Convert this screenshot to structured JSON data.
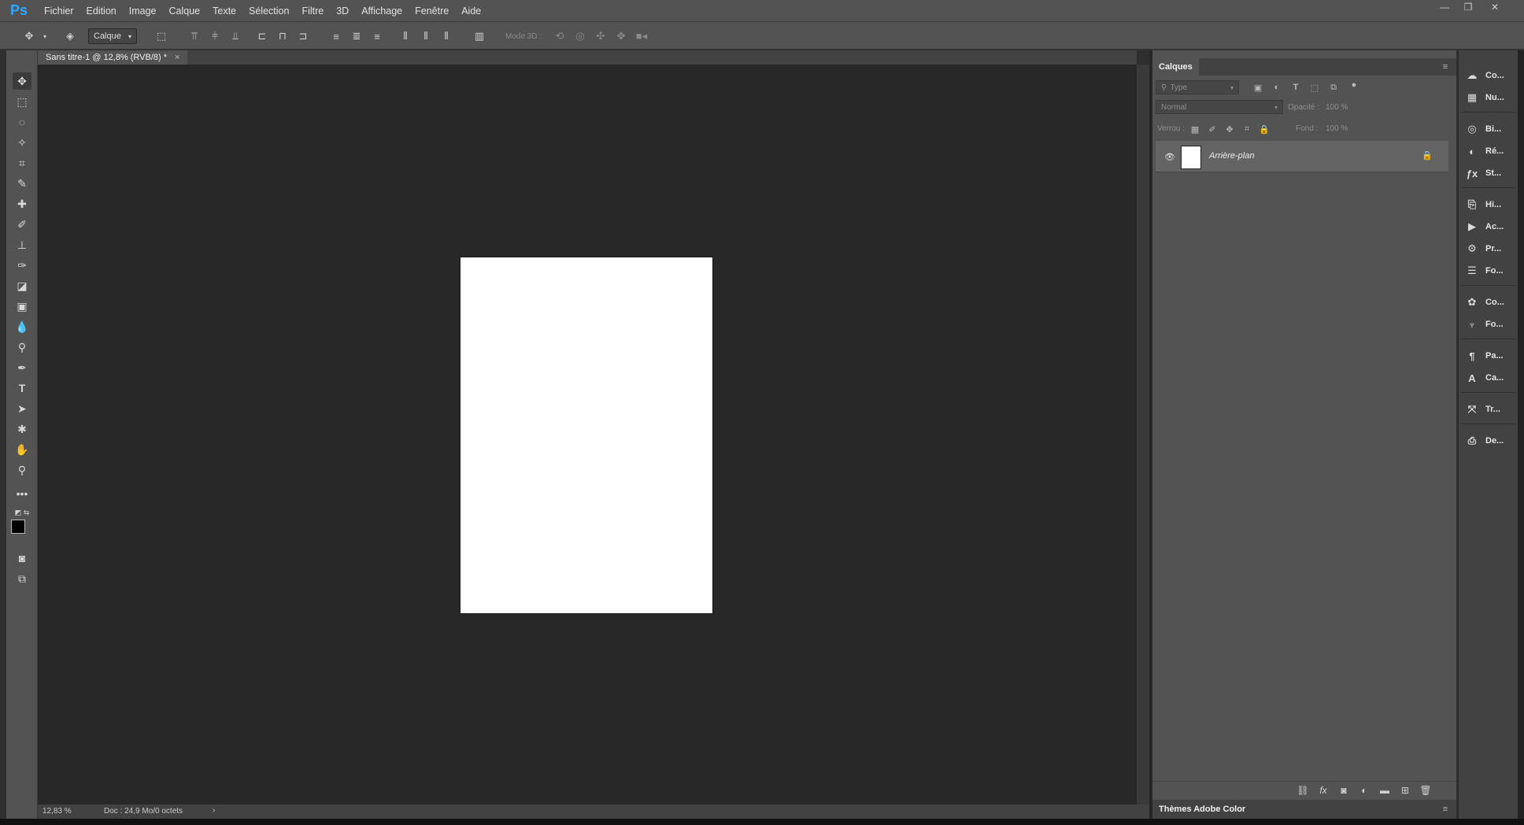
{
  "app": {
    "logo": "Ps",
    "menu": [
      "Fichier",
      "Edition",
      "Image",
      "Calque",
      "Texte",
      "Sélection",
      "Filtre",
      "3D",
      "Affichage",
      "Fenêtre",
      "Aide"
    ],
    "window_controls": [
      "—",
      "❐",
      "✕"
    ]
  },
  "options_bar": {
    "move_icon": "✥",
    "auto_select_label": "Calque",
    "mode3d_label": "Mode 3D :"
  },
  "document": {
    "tab_title": "Sans titre-1 @ 12,8% (RVB/8) *",
    "tab_close": "×",
    "paper_color": "#ffffff"
  },
  "status": {
    "zoom": "12,83 %",
    "doc_info": "Doc : 24,9 Mo/0 octets",
    "arrow": "›"
  },
  "layers_panel": {
    "title": "Calques",
    "filter_placeholder": "Type",
    "blend_mode": "Normal",
    "opacity_label": "Opacité :",
    "opacity_value": "100 %",
    "lock_label": "Verrou :",
    "fill_label": "Fond :",
    "fill_value": "100 %",
    "layers": [
      {
        "name": "Arrière-plan",
        "locked": true,
        "visible": true
      }
    ],
    "color_themes_title": "Thèmes Adobe Color"
  },
  "dock": {
    "items": [
      {
        "icon": "☁",
        "label": "Co..."
      },
      {
        "icon": "▦",
        "label": "Nu..."
      },
      {
        "icon": "◎",
        "label": "Bi..."
      },
      {
        "icon": "◐",
        "label": "Ré..."
      },
      {
        "icon": "ƒx",
        "label": "St..."
      },
      {
        "icon": "⎘",
        "label": "Hi..."
      },
      {
        "icon": "▶",
        "label": "Ac..."
      },
      {
        "icon": "⚙",
        "label": "Pr..."
      },
      {
        "icon": "☰",
        "label": "Fo..."
      },
      {
        "icon": "✿",
        "label": "Co..."
      },
      {
        "icon": "♆",
        "label": "Fo..."
      },
      {
        "icon": "¶",
        "label": "Pa..."
      },
      {
        "icon": "A",
        "label": "Ca..."
      },
      {
        "icon": "⤧",
        "label": "Tr..."
      },
      {
        "icon": "⎙",
        "label": "De..."
      }
    ]
  },
  "colors": {
    "menu_bg": "#535353",
    "canvas_bg": "#282828",
    "accent": "#31a8ff"
  }
}
